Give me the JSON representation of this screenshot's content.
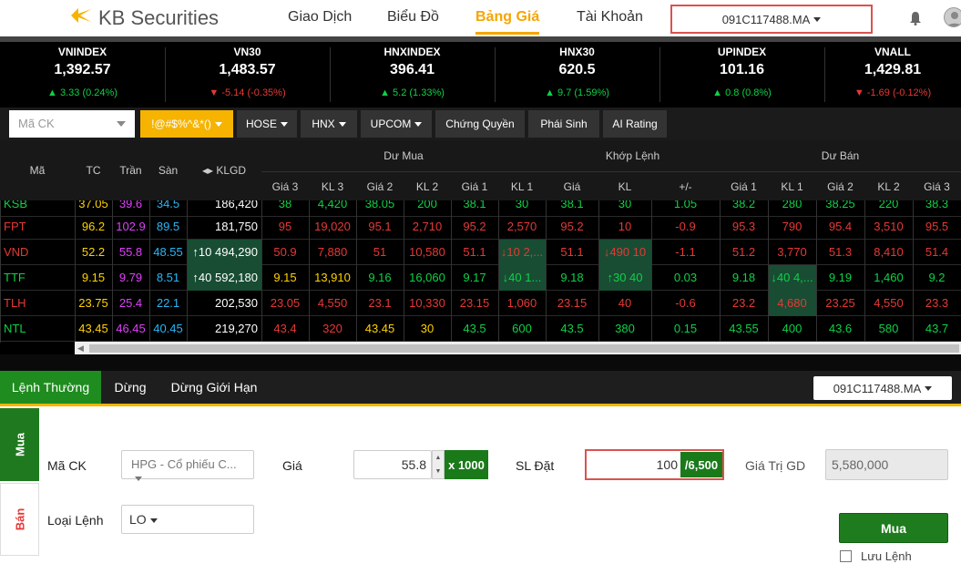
{
  "header": {
    "brand": "KB Securities",
    "nav": [
      {
        "label": "Giao Dịch"
      },
      {
        "label": "Biểu Đồ"
      },
      {
        "label": "Bảng Giá"
      },
      {
        "label": "Tài Khoản"
      }
    ],
    "account": "091C117488.MA"
  },
  "indices": [
    {
      "name": "VNINDEX",
      "value": "1,392.57",
      "change": "3.33 (0.24%)",
      "dir": "up"
    },
    {
      "name": "VN30",
      "value": "1,483.57",
      "change": "-5.14 (-0.35%)",
      "dir": "down"
    },
    {
      "name": "HNXINDEX",
      "value": "396.41",
      "change": "5.2 (1.33%)",
      "dir": "up"
    },
    {
      "name": "HNX30",
      "value": "620.5",
      "change": "9.7 (1.59%)",
      "dir": "up"
    },
    {
      "name": "UPINDEX",
      "value": "101.16",
      "change": "0.8 (0.8%)",
      "dir": "up"
    },
    {
      "name": "VNALL",
      "value": "1,429.81",
      "change": "-1.69 (-0.12%)",
      "dir": "down"
    }
  ],
  "toolbar": {
    "search_placeholder": "Mã CK",
    "tabs": [
      {
        "label": "!@#$%^&*()"
      },
      {
        "label": "HOSE"
      },
      {
        "label": "HNX"
      },
      {
        "label": "UPCOM"
      },
      {
        "label": "Chứng Quyền"
      },
      {
        "label": "Phái Sinh"
      },
      {
        "label": "AI Rating"
      }
    ]
  },
  "table": {
    "headers": {
      "ma": "Mã",
      "tc": "TC",
      "tran": "Trần",
      "san": "Sàn",
      "klgd": "KLGD",
      "du_mua": "Dư Mua",
      "khop_lenh": "Khớp Lệnh",
      "du_ban": "Dư Bán",
      "sub": [
        "Giá 3",
        "KL 3",
        "Giá 2",
        "KL 2",
        "Giá 1",
        "KL 1",
        "Giá",
        "KL",
        "+/-",
        "Giá 1",
        "KL 1",
        "Giá 2",
        "KL 2",
        "Giá 3"
      ]
    },
    "rows": [
      {
        "cells": [
          "KSB",
          "37.05",
          "39.6",
          "34.5",
          "186,420",
          "38",
          "4,420",
          "38.05",
          "200",
          "38.1",
          "30",
          "38.1",
          "30",
          "1.05",
          "38.2",
          "280",
          "38.25",
          "220",
          "38.3"
        ],
        "colors": [
          "#0ed146",
          "#ffd200",
          "#e040fb",
          "#29b6f6",
          "#fff",
          "#0ed146",
          "#0ed146",
          "#0ed146",
          "#0ed146",
          "#0ed146",
          "#0ed146",
          "#0ed146",
          "#0ed146",
          "#0ed146",
          "#0ed146",
          "#0ed146",
          "#0ed146",
          "#0ed146",
          "#0ed146"
        ]
      },
      {
        "cells": [
          "FPT",
          "96.2",
          "102.9",
          "89.5",
          "181,750",
          "95",
          "19,020",
          "95.1",
          "2,710",
          "95.2",
          "2,570",
          "95.2",
          "10",
          "-0.9",
          "95.3",
          "790",
          "95.4",
          "3,510",
          "95.5"
        ],
        "colors": [
          "#e53935",
          "#ffd200",
          "#e040fb",
          "#29b6f6",
          "#fff",
          "#e53935",
          "#e53935",
          "#e53935",
          "#e53935",
          "#e53935",
          "#e53935",
          "#e53935",
          "#e53935",
          "#e53935",
          "#e53935",
          "#e53935",
          "#e53935",
          "#e53935",
          "#e53935"
        ]
      },
      {
        "cells": [
          "VND",
          "52.2",
          "55.8",
          "48.55",
          "↑10 494,290",
          "50.9",
          "7,880",
          "51",
          "10,580",
          "51.1",
          "↓10 2,...",
          "51.1",
          "↓490 10",
          "-1.1",
          "51.2",
          "3,770",
          "51.3",
          "8,410",
          "51.4"
        ],
        "colors": [
          "#e53935",
          "#ffd200",
          "#e040fb",
          "#29b6f6",
          "#fff",
          "#e53935",
          "#e53935",
          "#e53935",
          "#e53935",
          "#e53935",
          "#e53935",
          "#e53935",
          "#e53935",
          "#e53935",
          "#e53935",
          "#e53935",
          "#e53935",
          "#e53935",
          "#e53935"
        ]
      },
      {
        "cells": [
          "TTF",
          "9.15",
          "9.79",
          "8.51",
          "↑40 592,180",
          "9.15",
          "13,910",
          "9.16",
          "16,060",
          "9.17",
          "↓40 1...",
          "9.18",
          "↑30 40",
          "0.03",
          "9.18",
          "↓40 4,...",
          "9.19",
          "1,460",
          "9.2"
        ],
        "colors": [
          "#0ed146",
          "#ffd200",
          "#e040fb",
          "#29b6f6",
          "#fff",
          "#ffd200",
          "#ffd200",
          "#0ed146",
          "#0ed146",
          "#0ed146",
          "#0ed146",
          "#0ed146",
          "#0ed146",
          "#0ed146",
          "#0ed146",
          "#0ed146",
          "#0ed146",
          "#0ed146",
          "#0ed146"
        ]
      },
      {
        "cells": [
          "TLH",
          "23.75",
          "25.4",
          "22.1",
          "202,530",
          "23.05",
          "4,550",
          "23.1",
          "10,330",
          "23.15",
          "1,060",
          "23.15",
          "40",
          "-0.6",
          "23.2",
          "4,680",
          "23.25",
          "4,550",
          "23.3"
        ],
        "colors": [
          "#e53935",
          "#ffd200",
          "#e040fb",
          "#29b6f6",
          "#fff",
          "#e53935",
          "#e53935",
          "#e53935",
          "#e53935",
          "#e53935",
          "#e53935",
          "#e53935",
          "#e53935",
          "#e53935",
          "#e53935",
          "#e53935",
          "#e53935",
          "#e53935",
          "#e53935"
        ]
      },
      {
        "cells": [
          "NTL",
          "43.45",
          "46.45",
          "40.45",
          "219,270",
          "43.4",
          "320",
          "43.45",
          "30",
          "43.5",
          "600",
          "43.5",
          "380",
          "0.15",
          "43.55",
          "400",
          "43.6",
          "580",
          "43.7"
        ],
        "colors": [
          "#0ed146",
          "#ffd200",
          "#e040fb",
          "#29b6f6",
          "#fff",
          "#e53935",
          "#e53935",
          "#ffd200",
          "#ffd200",
          "#0ed146",
          "#0ed146",
          "#0ed146",
          "#0ed146",
          "#0ed146",
          "#0ed146",
          "#0ed146",
          "#0ed146",
          "#0ed146",
          "#0ed146"
        ]
      }
    ]
  },
  "order": {
    "tabs": [
      {
        "label": "Lệnh Thường"
      },
      {
        "label": "Dừng"
      },
      {
        "label": "Dừng Giới Hạn"
      }
    ],
    "account": "091C117488.MA",
    "side_buy": "Mua",
    "side_sell": "Bán",
    "symbol_label": "Mã CK",
    "symbol_value": "HPG - Cổ phiếu C...",
    "type_label": "Loại Lệnh",
    "type_value": "LO",
    "price_label": "Giá",
    "price_value": "55.8",
    "price_multiplier": "x 1000",
    "qty_label": "SL Đặt",
    "qty_value": "100",
    "qty_max": "/6,500",
    "value_label": "Giá Trị GD",
    "value_value": "5,580,000",
    "submit": "Mua",
    "save_label": "Lưu Lệnh"
  }
}
